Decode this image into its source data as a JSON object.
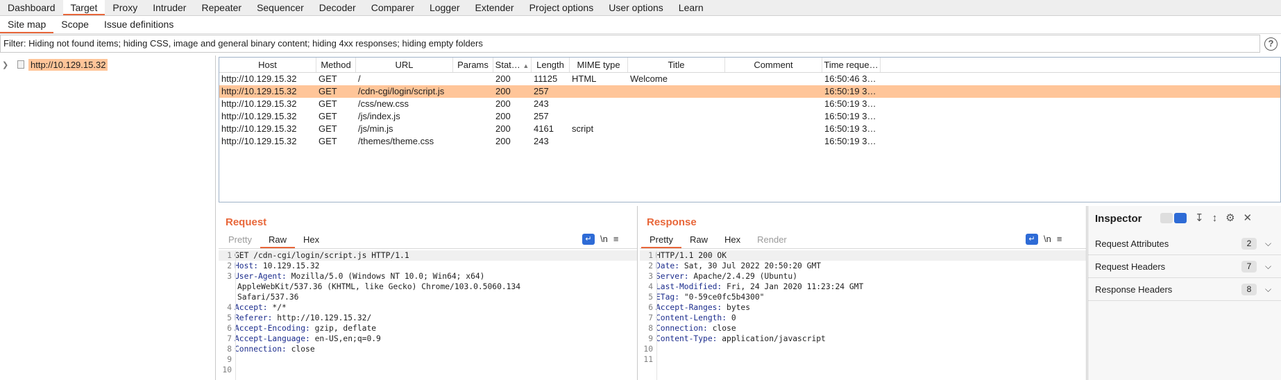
{
  "main_tabs": [
    "Dashboard",
    "Target",
    "Proxy",
    "Intruder",
    "Repeater",
    "Sequencer",
    "Decoder",
    "Comparer",
    "Logger",
    "Extender",
    "Project options",
    "User options",
    "Learn"
  ],
  "sub_tabs": [
    "Site map",
    "Scope",
    "Issue definitions"
  ],
  "filter_text": "Filter: Hiding not found items;  hiding CSS, image and general binary content;  hiding 4xx responses;  hiding empty folders",
  "help_symbol": "?",
  "tree": {
    "host": "http://10.129.15.32"
  },
  "table": {
    "columns": [
      "Host",
      "Method",
      "URL",
      "Params",
      "Stat…",
      "Length",
      "MIME type",
      "Title",
      "Comment",
      "Time reque…"
    ],
    "rows": [
      {
        "host": "http://10.129.15.32",
        "method": "GET",
        "url": "/",
        "params": "",
        "status": "200",
        "length": "11125",
        "mime": "HTML",
        "title": "Welcome",
        "comment": "",
        "time": "16:50:46 3…"
      },
      {
        "host": "http://10.129.15.32",
        "method": "GET",
        "url": "/cdn-cgi/login/script.js",
        "params": "",
        "status": "200",
        "length": "257",
        "mime": "",
        "title": "",
        "comment": "",
        "time": "16:50:19 3…"
      },
      {
        "host": "http://10.129.15.32",
        "method": "GET",
        "url": "/css/new.css",
        "params": "",
        "status": "200",
        "length": "243",
        "mime": "",
        "title": "",
        "comment": "",
        "time": "16:50:19 3…"
      },
      {
        "host": "http://10.129.15.32",
        "method": "GET",
        "url": "/js/index.js",
        "params": "",
        "status": "200",
        "length": "257",
        "mime": "",
        "title": "",
        "comment": "",
        "time": "16:50:19 3…"
      },
      {
        "host": "http://10.129.15.32",
        "method": "GET",
        "url": "/js/min.js",
        "params": "",
        "status": "200",
        "length": "4161",
        "mime": "script",
        "title": "",
        "comment": "",
        "time": "16:50:19 3…"
      },
      {
        "host": "http://10.129.15.32",
        "method": "GET",
        "url": "/themes/theme.css",
        "params": "",
        "status": "200",
        "length": "243",
        "mime": "",
        "title": "",
        "comment": "",
        "time": "16:50:19 3…"
      }
    ]
  },
  "request": {
    "title": "Request",
    "tabs": [
      "Pretty",
      "Raw",
      "Hex"
    ],
    "newline_icon": "\\n",
    "menu_icon": "≡",
    "lines": [
      {
        "key": "",
        "val": "GET /cdn-cgi/login/script.js HTTP/1.1"
      },
      {
        "key": "Host:",
        "val": " 10.129.15.32"
      },
      {
        "key": "User-Agent:",
        "val": " Mozilla/5.0 (Windows NT 10.0; Win64; x64)",
        "cont": [
          "AppleWebKit/537.36 (KHTML, like Gecko) Chrome/103.0.5060.134",
          "Safari/537.36"
        ]
      },
      {
        "key": "Accept:",
        "val": " */*"
      },
      {
        "key": "Referer:",
        "val": " http://10.129.15.32/"
      },
      {
        "key": "Accept-Encoding:",
        "val": " gzip, deflate"
      },
      {
        "key": "Accept-Language:",
        "val": " en-US,en;q=0.9"
      },
      {
        "key": "Connection:",
        "val": " close"
      },
      {
        "key": "",
        "val": ""
      },
      {
        "key": "",
        "val": ""
      }
    ]
  },
  "response": {
    "title": "Response",
    "tabs": [
      "Pretty",
      "Raw",
      "Hex",
      "Render"
    ],
    "newline_icon": "\\n",
    "menu_icon": "≡",
    "lines": [
      {
        "key": "",
        "val": "HTTP/1.1 200 OK"
      },
      {
        "key": "Date:",
        "val": " Sat, 30 Jul 2022 20:50:20 GMT"
      },
      {
        "key": "Server:",
        "val": " Apache/2.4.29 (Ubuntu)"
      },
      {
        "key": "Last-Modified:",
        "val": " Fri, 24 Jan 2020 11:23:24 GMT"
      },
      {
        "key": "ETag:",
        "val": " \"0-59ce0fc5b4300\""
      },
      {
        "key": "Accept-Ranges:",
        "val": " bytes"
      },
      {
        "key": "Content-Length:",
        "val": " 0"
      },
      {
        "key": "Connection:",
        "val": " close"
      },
      {
        "key": "Content-Type:",
        "val": " application/javascript"
      },
      {
        "key": "",
        "val": ""
      },
      {
        "key": "",
        "val": ""
      }
    ]
  },
  "inspector": {
    "title": "Inspector",
    "sections": [
      {
        "label": "Request Attributes",
        "count": "2"
      },
      {
        "label": "Request Headers",
        "count": "7"
      },
      {
        "label": "Response Headers",
        "count": "8"
      }
    ]
  },
  "colors": {
    "accent": "#e8673a",
    "selection": "#ffc599",
    "blue": "#2e6bd6"
  }
}
